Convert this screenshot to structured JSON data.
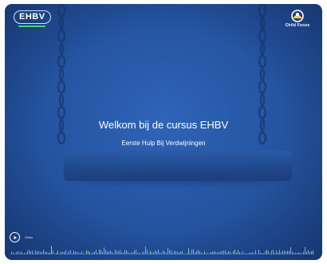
{
  "brand": {
    "logo_text": "EHBV"
  },
  "partner": {
    "name": "Child Focus"
  },
  "hero": {
    "title": "Welkom bij de cursus EHBV",
    "subtitle": "Eerste Hulp Bij Verdwijningen"
  },
  "player": {
    "label": "Video"
  },
  "colors": {
    "background": "#2656a4",
    "logo_accent": "#4dd07a",
    "text": "#ffffff"
  }
}
